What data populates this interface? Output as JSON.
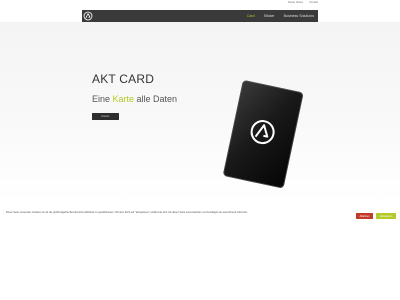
{
  "top_links": [
    "Kasse Status",
    "Kontakt"
  ],
  "nav": {
    "logo_icon": "akt-logo-icon",
    "items": [
      {
        "label": "Card",
        "active": true
      },
      {
        "label": "Sticker",
        "active": false
      },
      {
        "label": "Business Solutions",
        "active": false
      }
    ]
  },
  "hero": {
    "title": "AKT CARD",
    "subtitle_before": "Eine ",
    "subtitle_accent": "Karte",
    "subtitle_after": " alle Daten",
    "button_label": "Kaufen",
    "card_icon": "akt-logo-icon"
  },
  "cookie": {
    "text": "Diese Seite verwendet Cookies um dir die größtmögliche Benutzerfreundlichkeit zu gewährleisten. Mit dem Klick auf \"akzeptieren\" erklärst du dich mit dieser Seite einverstanden und bestätigst sie ausreichend informiert.",
    "decline_label": "Ablehnen",
    "accept_label": "Akzeptieren"
  },
  "colors": {
    "accent": "#b5c929",
    "nav_bg": "#3a3a3a",
    "decline": "#c0392b"
  }
}
